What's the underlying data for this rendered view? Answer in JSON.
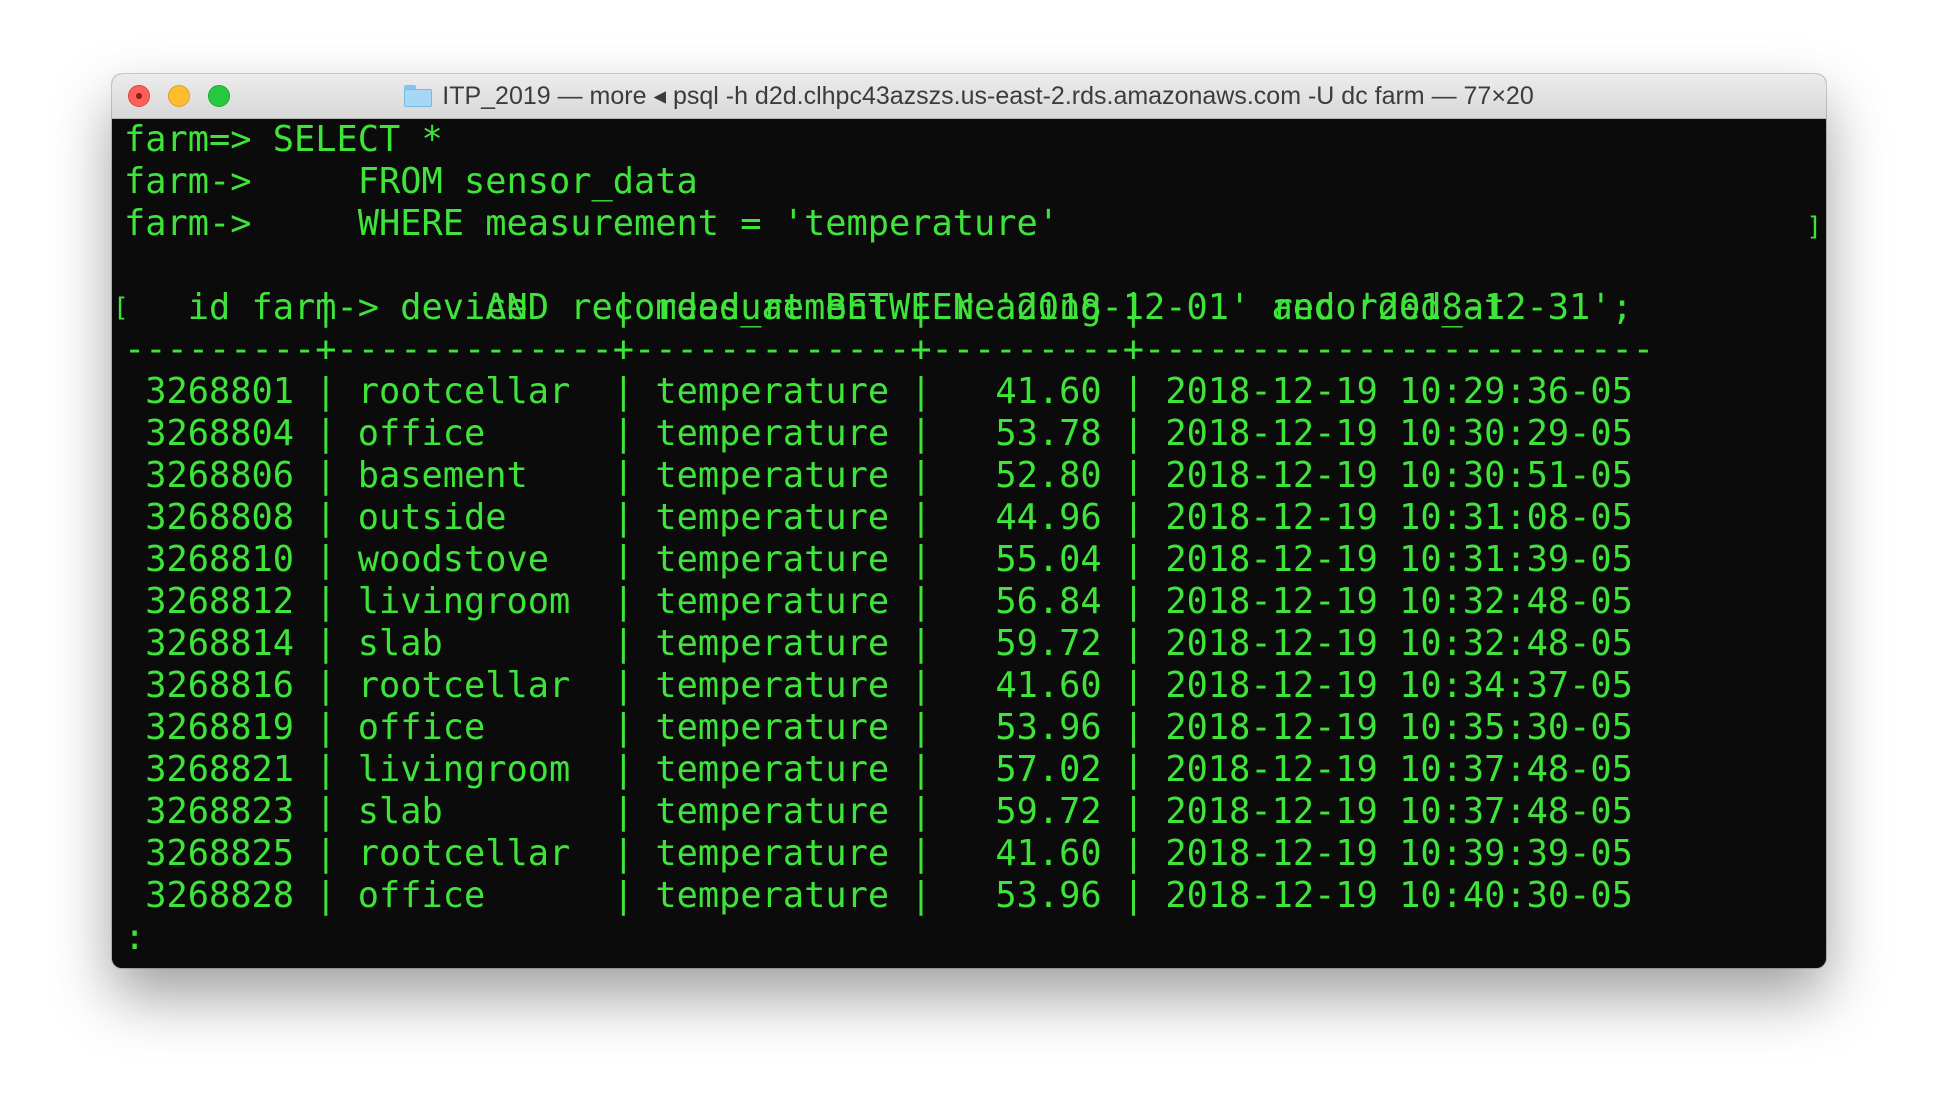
{
  "window": {
    "title": "ITP_2019 — more ◂ psql -h d2d.clhpc43azszs.us-east-2.rds.amazonaws.com -U dc farm — 77×20"
  },
  "colors": {
    "terminal_text": "#3fe43a",
    "terminal_bg": "#0b0b0b",
    "close": "#fe5f57",
    "minimize": "#febc2e",
    "zoom": "#28c840"
  },
  "query_lines": [
    "farm=> SELECT *",
    "farm->     FROM sensor_data",
    "farm->     WHERE measurement = 'temperature'",
    "farm->     AND recorded_at BETWEEN '2018-12-01' and '2018-12-31';"
  ],
  "bracket_left": "[",
  "bracket_right": "]",
  "header_line": "   id    |   device    | measurement | reading |      recorded_at",
  "rule_line": "---------+-------------+-------------+---------+------------------------",
  "columns": [
    "id",
    "device",
    "measurement",
    "reading",
    "recorded_at"
  ],
  "rows": [
    [
      "3268801",
      "rootcellar",
      "temperature",
      "41.60",
      "2018-12-19 10:29:36-05"
    ],
    [
      "3268804",
      "office",
      "temperature",
      "53.78",
      "2018-12-19 10:30:29-05"
    ],
    [
      "3268806",
      "basement",
      "temperature",
      "52.80",
      "2018-12-19 10:30:51-05"
    ],
    [
      "3268808",
      "outside",
      "temperature",
      "44.96",
      "2018-12-19 10:31:08-05"
    ],
    [
      "3268810",
      "woodstove",
      "temperature",
      "55.04",
      "2018-12-19 10:31:39-05"
    ],
    [
      "3268812",
      "livingroom",
      "temperature",
      "56.84",
      "2018-12-19 10:32:48-05"
    ],
    [
      "3268814",
      "slab",
      "temperature",
      "59.72",
      "2018-12-19 10:32:48-05"
    ],
    [
      "3268816",
      "rootcellar",
      "temperature",
      "41.60",
      "2018-12-19 10:34:37-05"
    ],
    [
      "3268819",
      "office",
      "temperature",
      "53.96",
      "2018-12-19 10:35:30-05"
    ],
    [
      "3268821",
      "livingroom",
      "temperature",
      "57.02",
      "2018-12-19 10:37:48-05"
    ],
    [
      "3268823",
      "slab",
      "temperature",
      "59.72",
      "2018-12-19 10:37:48-05"
    ],
    [
      "3268825",
      "rootcellar",
      "temperature",
      "41.60",
      "2018-12-19 10:39:39-05"
    ],
    [
      "3268828",
      "office",
      "temperature",
      "53.96",
      "2018-12-19 10:40:30-05"
    ]
  ],
  "pager_prompt": ":"
}
